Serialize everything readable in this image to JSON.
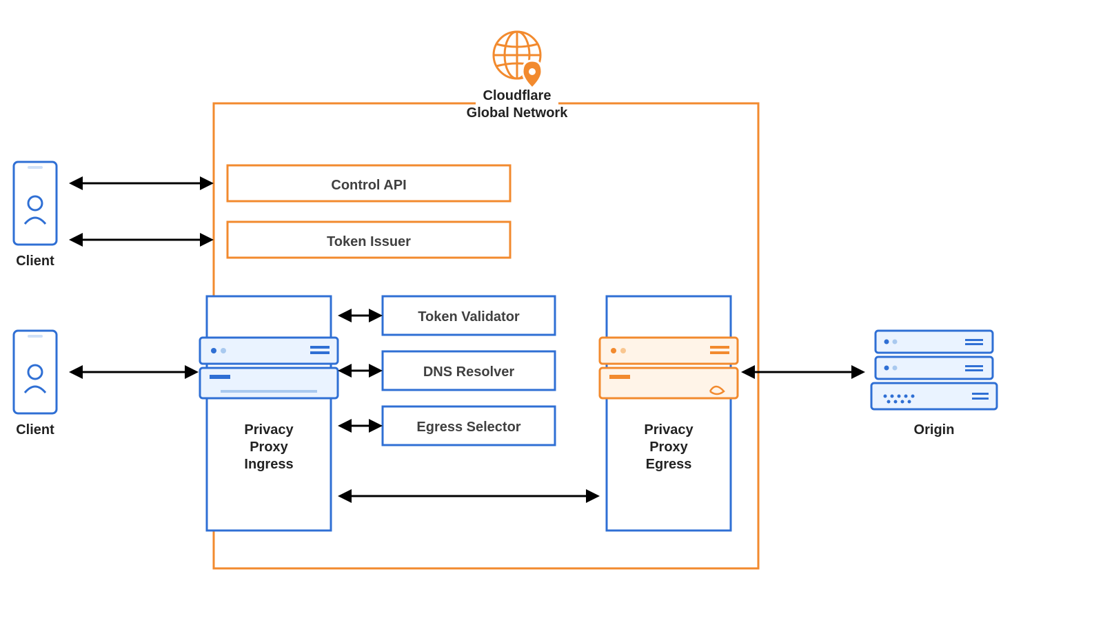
{
  "diagram": {
    "title": "Cloudflare Global Network",
    "client": "Client",
    "origin": "Origin",
    "controlApi": "Control API",
    "tokenIssuer": "Token Issuer",
    "tokenValidator": "Token Validator",
    "dnsResolver": "DNS Resolver",
    "egressSelector": "Egress Selector",
    "ingress1": "Privacy",
    "ingress2": "Proxy",
    "ingress3": "Ingress",
    "egress1": "Privacy",
    "egress2": "Proxy",
    "egress3": "Egress"
  },
  "colors": {
    "orange": "#f28a2e",
    "blue": "#2f6fd4",
    "text": "#404040"
  }
}
